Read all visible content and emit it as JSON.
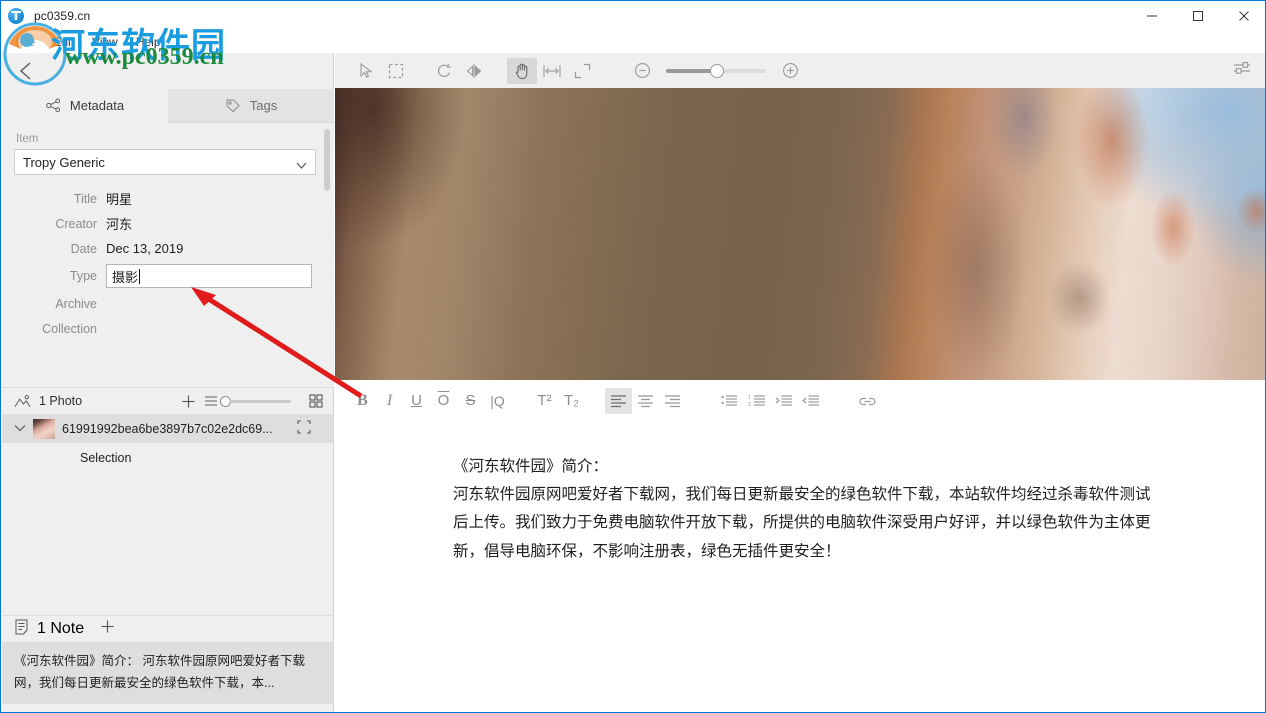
{
  "window": {
    "title": "pc0359.cn",
    "app_icon": "tropy-icon",
    "minimize_label": "Minimize",
    "maximize_label": "Maximize",
    "close_label": "Close"
  },
  "menubar": {
    "items": [
      "File",
      "Edit",
      "View",
      "Help"
    ]
  },
  "watermark": {
    "logo": "pc0359-logo",
    "chinese": "河东软件园",
    "url": "www.pc0359.cn"
  },
  "sidebar": {
    "back_label": "Back",
    "tabs": [
      {
        "label": "Metadata",
        "icon": "share-nodes-icon",
        "active": true
      },
      {
        "label": "Tags",
        "icon": "tag-icon",
        "active": false
      }
    ],
    "metadata": {
      "section_label": "Item",
      "template": "Tropy Generic",
      "fields": [
        {
          "label": "Title",
          "value": "明星",
          "editing": false
        },
        {
          "label": "Creator",
          "value": "河东",
          "editing": false
        },
        {
          "label": "Date",
          "value": "Dec 13, 2019",
          "editing": false
        },
        {
          "label": "Type",
          "value": "摄影",
          "editing": true
        },
        {
          "label": "Archive",
          "value": "",
          "editing": false
        },
        {
          "label": "Collection",
          "value": "",
          "editing": false
        }
      ]
    },
    "photos": {
      "header": "1 Photo",
      "header_icon": "photo-icon",
      "add_label": "+",
      "list_view_icon": "list-icon",
      "grid_view_icon": "grid-icon",
      "items": [
        {
          "name": "61991992bea6be3897b7c02e2dc69...",
          "expand_icon": "chevron-down-icon",
          "selection_icon": "crop-icon",
          "children": [
            "Selection"
          ]
        }
      ]
    },
    "notes": {
      "header": "1 Note",
      "header_icon": "note-icon",
      "add_label": "+",
      "items": [
        "《河东软件园》简介： 河东软件园原网吧爱好者下载网，我们每日更新最安全的绿色软件下载，本..."
      ]
    }
  },
  "viewer": {
    "toolbar": [
      {
        "name": "select-arrow",
        "icon": "arrow-cursor-icon",
        "active": false
      },
      {
        "name": "marquee-select",
        "icon": "marquee-icon",
        "active": false
      },
      {
        "name": "rotate",
        "icon": "rotate-ccw-icon",
        "active": false
      },
      {
        "name": "flip-horizontal",
        "icon": "flip-icon",
        "active": false
      },
      {
        "name": "pan",
        "icon": "hand-icon",
        "active": true
      },
      {
        "name": "fit-width",
        "icon": "fit-width-icon",
        "active": false
      },
      {
        "name": "fit-screen",
        "icon": "fit-screen-icon",
        "active": false
      }
    ],
    "zoom": {
      "out_icon": "zoom-out-icon",
      "in_icon": "zoom-in-icon",
      "value_percent": 50
    },
    "settings_icon": "sliders-icon",
    "image_alt": "zoomed-photograph"
  },
  "editor": {
    "toolbar": [
      {
        "name": "bold",
        "label": "B",
        "active": false
      },
      {
        "name": "italic",
        "label": "I",
        "active": false
      },
      {
        "name": "underline",
        "label": "U",
        "active": false
      },
      {
        "name": "overline",
        "label": "O",
        "active": false
      },
      {
        "name": "strikethrough",
        "label": "S",
        "active": false
      },
      {
        "name": "blockquote",
        "label": "|Q",
        "active": false
      },
      {
        "name": "superscript",
        "label": "T²",
        "active": false
      },
      {
        "name": "subscript",
        "label": "T₂",
        "active": false
      },
      {
        "name": "align-left",
        "icon": "align-left-icon",
        "active": true
      },
      {
        "name": "align-center",
        "icon": "align-center-icon",
        "active": false
      },
      {
        "name": "align-right",
        "icon": "align-right-icon",
        "active": false
      },
      {
        "name": "bullet-list",
        "icon": "bullet-list-icon",
        "active": false
      },
      {
        "name": "ordered-list",
        "icon": "ordered-list-icon",
        "active": false
      },
      {
        "name": "indent",
        "icon": "indent-icon",
        "active": false
      },
      {
        "name": "outdent",
        "icon": "outdent-icon",
        "active": false
      },
      {
        "name": "link",
        "icon": "link-icon",
        "active": false
      }
    ],
    "content": [
      "《河东软件园》简介：",
      "河东软件园原网吧爱好者下载网，我们每日更新最安全的绿色软件下载，本站软件均经过杀毒软件测试后上传。我们致力于免费电脑软件开放下载，所提供的电脑软件深受用户好评，并以绿色软件为主体更新，倡导电脑环保，不影响注册表，绿色无插件更安全！"
    ]
  },
  "annotation": {
    "arrow_color": "#e01b1b",
    "from": "type-field",
    "to": "editor-area"
  },
  "colors": {
    "accent": "#0078d7",
    "panel_bg": "#efefef",
    "selected_row": "#dedede",
    "watermark_blue": "#1a9de0",
    "watermark_green": "#1c8a3c"
  }
}
